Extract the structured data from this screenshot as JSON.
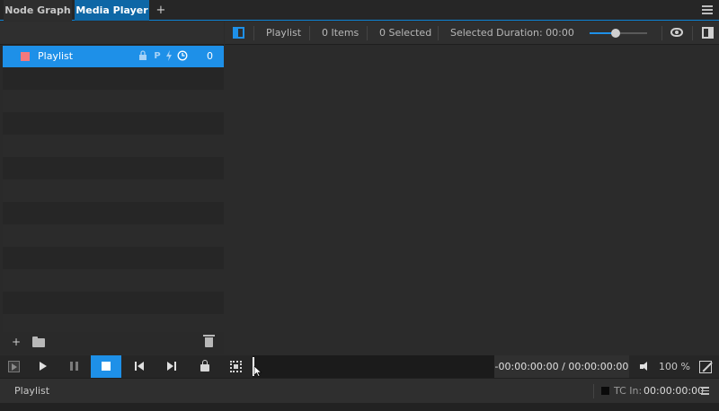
{
  "tabs": [
    {
      "label": "Node Graph",
      "active": false
    },
    {
      "label": "Media Player",
      "active": true
    }
  ],
  "tab_add_label": "+",
  "playlist_panel": {
    "items": [
      {
        "name": "Playlist",
        "count": "0",
        "color": "#f4797c",
        "selected": true
      }
    ],
    "item_flag_p": "P"
  },
  "toolbar": {
    "playlist_label": "Playlist",
    "items_count": "0 Items",
    "selected_count": "0 Selected",
    "selected_duration": "Selected Duration: 00:00",
    "zoom_level": 0.45
  },
  "footer": {
    "add_label": "+"
  },
  "transport": {
    "timecode": "-00:00:00:00 / 00:00:00:00",
    "volume": "100 %",
    "accent": "#1e90e8"
  },
  "status": {
    "label": "Playlist",
    "tc_in_label": "TC In:",
    "tc_in_value": "00:00:00:00"
  }
}
